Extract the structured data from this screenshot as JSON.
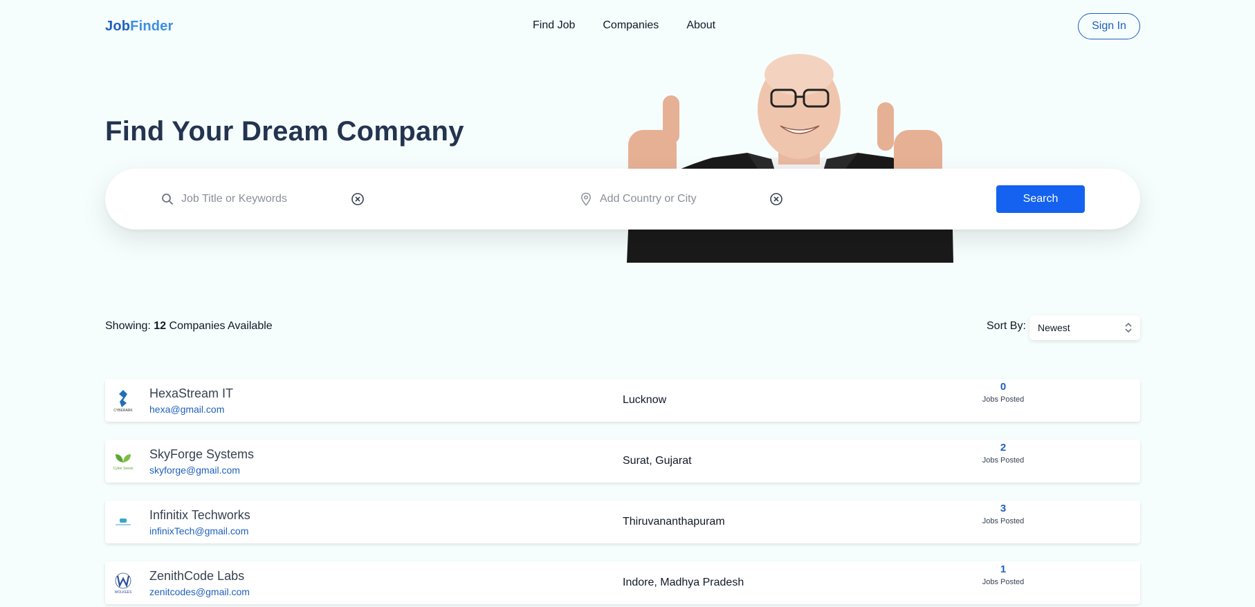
{
  "nav": {
    "logo_part1": "Job",
    "logo_part2": "Finder",
    "links": [
      "Find Job",
      "Companies",
      "About"
    ],
    "signin_label": "Sign In"
  },
  "hero": {
    "title": "Find Your Dream Company"
  },
  "search": {
    "keywords_placeholder": "Job Title or Keywords",
    "location_placeholder": "Add Country or City",
    "button_label": "Search"
  },
  "results": {
    "showing_prefix": "Showing:",
    "count": "12",
    "showing_suffix": "Companies Available",
    "sort_label": "Sort By:",
    "sort_value": "Newest"
  },
  "companies": [
    {
      "name": "HexaStream IT",
      "email": "hexa@gmail.com",
      "location": "Lucknow",
      "jobs": "0",
      "jobs_label": "Jobs Posted",
      "logo_text": "CYBERARK",
      "logo_color": "#1e6fb8"
    },
    {
      "name": "SkyForge Systems",
      "email": "skyforge@gmail.com",
      "location": "Surat, Gujarat",
      "jobs": "2",
      "jobs_label": "Jobs Posted",
      "logo_text": "Cyber Seeds",
      "logo_color": "#5aa832"
    },
    {
      "name": "Infinitix Techworks",
      "email": "infinixTech@gmail.com",
      "location": "Thiruvananthapuram",
      "jobs": "3",
      "jobs_label": "Jobs Posted",
      "logo_text": "",
      "logo_color": "#3aa6c8"
    },
    {
      "name": "ZenithCode Labs",
      "email": "zenitcodes@gmail.com",
      "location": "Indore, Madhya Pradesh",
      "jobs": "1",
      "jobs_label": "Jobs Posted",
      "logo_text": "WOLKEES",
      "logo_color": "#2b4f9c"
    }
  ],
  "colors": {
    "accent": "#1462ef",
    "brand": "#1e5fbf",
    "background": "#f6fdfd"
  }
}
